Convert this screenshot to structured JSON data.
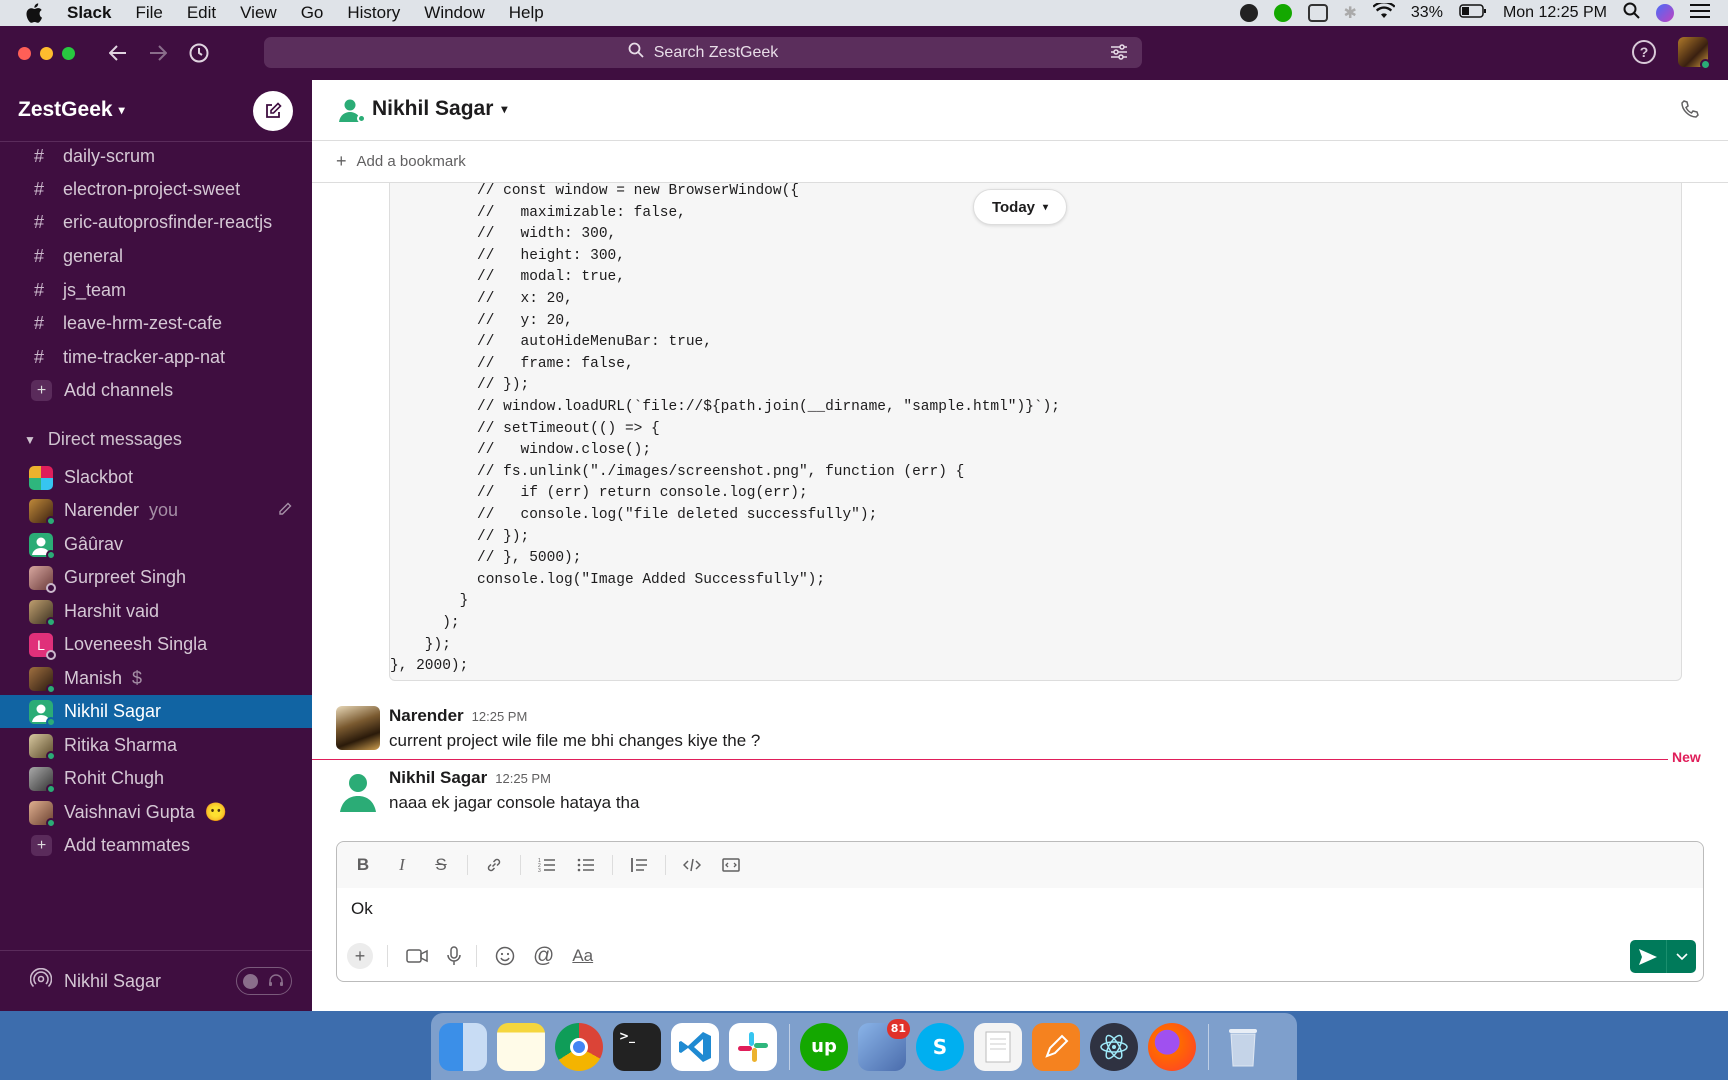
{
  "menubar": {
    "app_name": "Slack",
    "items": [
      "File",
      "Edit",
      "View",
      "Go",
      "History",
      "Window",
      "Help"
    ],
    "battery": "33%",
    "clock": "Mon 12:25 PM"
  },
  "titlebar": {
    "search_placeholder": "Search ZestGeek"
  },
  "sidebar": {
    "workspace": "ZestGeek",
    "channels": [
      "daily-scrum",
      "electron-project-sweet",
      "eric-autoprosfinder-reactjs",
      "general",
      "js_team",
      "leave-hrm-zest-cafe",
      "time-tracker-app-nat"
    ],
    "add_channels": "Add channels",
    "dm_header": "Direct messages",
    "dms": [
      {
        "name": "Slackbot",
        "color": "#e8a33c"
      },
      {
        "name": "Narender",
        "tag": "you",
        "color": "#8a5a2a"
      },
      {
        "name": "Gâûrav",
        "color": "#2bac76"
      },
      {
        "name": "Gurpreet Singh",
        "color": "#a06a6a"
      },
      {
        "name": "Harshit vaid",
        "color": "#7a6a4a"
      },
      {
        "name": "Loveneesh Singla",
        "initial": "L",
        "color": "#e0307a"
      },
      {
        "name": "Manish",
        "extra": "$",
        "color": "#6a4a2a"
      },
      {
        "name": "Nikhil Sagar",
        "color": "#2bac76"
      },
      {
        "name": "Ritika Sharma",
        "color": "#9a8a6a"
      },
      {
        "name": "Rohit Chugh",
        "color": "#5a5a5a"
      },
      {
        "name": "Vaishnavi Gupta",
        "emoji": "😶",
        "color": "#a07050"
      }
    ],
    "add_teammates": "Add teammates",
    "footer_user": "Nikhil Sagar"
  },
  "channel": {
    "title": "Nikhil Sagar",
    "add_bookmark": "Add a bookmark",
    "date_divider": "Today"
  },
  "code_lines": [
    "          // const window = new BrowserWindow({",
    "          //   maximizable: false,",
    "          //   width: 300,",
    "          //   height: 300,",
    "          //   modal: true,",
    "          //   x: 20,",
    "          //   y: 20,",
    "          //   autoHideMenuBar: true,",
    "          //   frame: false,",
    "          // });",
    "          // window.loadURL(`file://${path.join(__dirname, \"sample.html\")}`);",
    "          // setTimeout(() => {",
    "          //   window.close();",
    "          // fs.unlink(\"./images/screenshot.png\", function (err) {",
    "          //   if (err) return console.log(err);",
    "          //   console.log(\"file deleted successfully\");",
    "          // });",
    "          // }, 5000);",
    "          console.log(\"Image Added Successfully\");",
    "        }",
    "      );",
    "    });",
    "}, 2000);"
  ],
  "messages": [
    {
      "author": "Narender",
      "time": "12:25 PM",
      "text": "current project wile file me bhi changes kiye the ?"
    },
    {
      "author": "Nikhil Sagar",
      "time": "12:25 PM",
      "text": "naaa ek jagar console hataya tha"
    }
  ],
  "new_marker": "New",
  "composer": {
    "value": "Ok",
    "format_labels": {
      "bold": "B",
      "italic": "I",
      "strike": "S",
      "font": "Aa"
    }
  },
  "dock": {
    "mail_badge": "81"
  },
  "colors": {
    "aubergine": "#3f0e40",
    "active_blue": "#1164a3",
    "send_green": "#007a5a",
    "new_red": "#e01e5a",
    "presence_green": "#2bac76"
  }
}
